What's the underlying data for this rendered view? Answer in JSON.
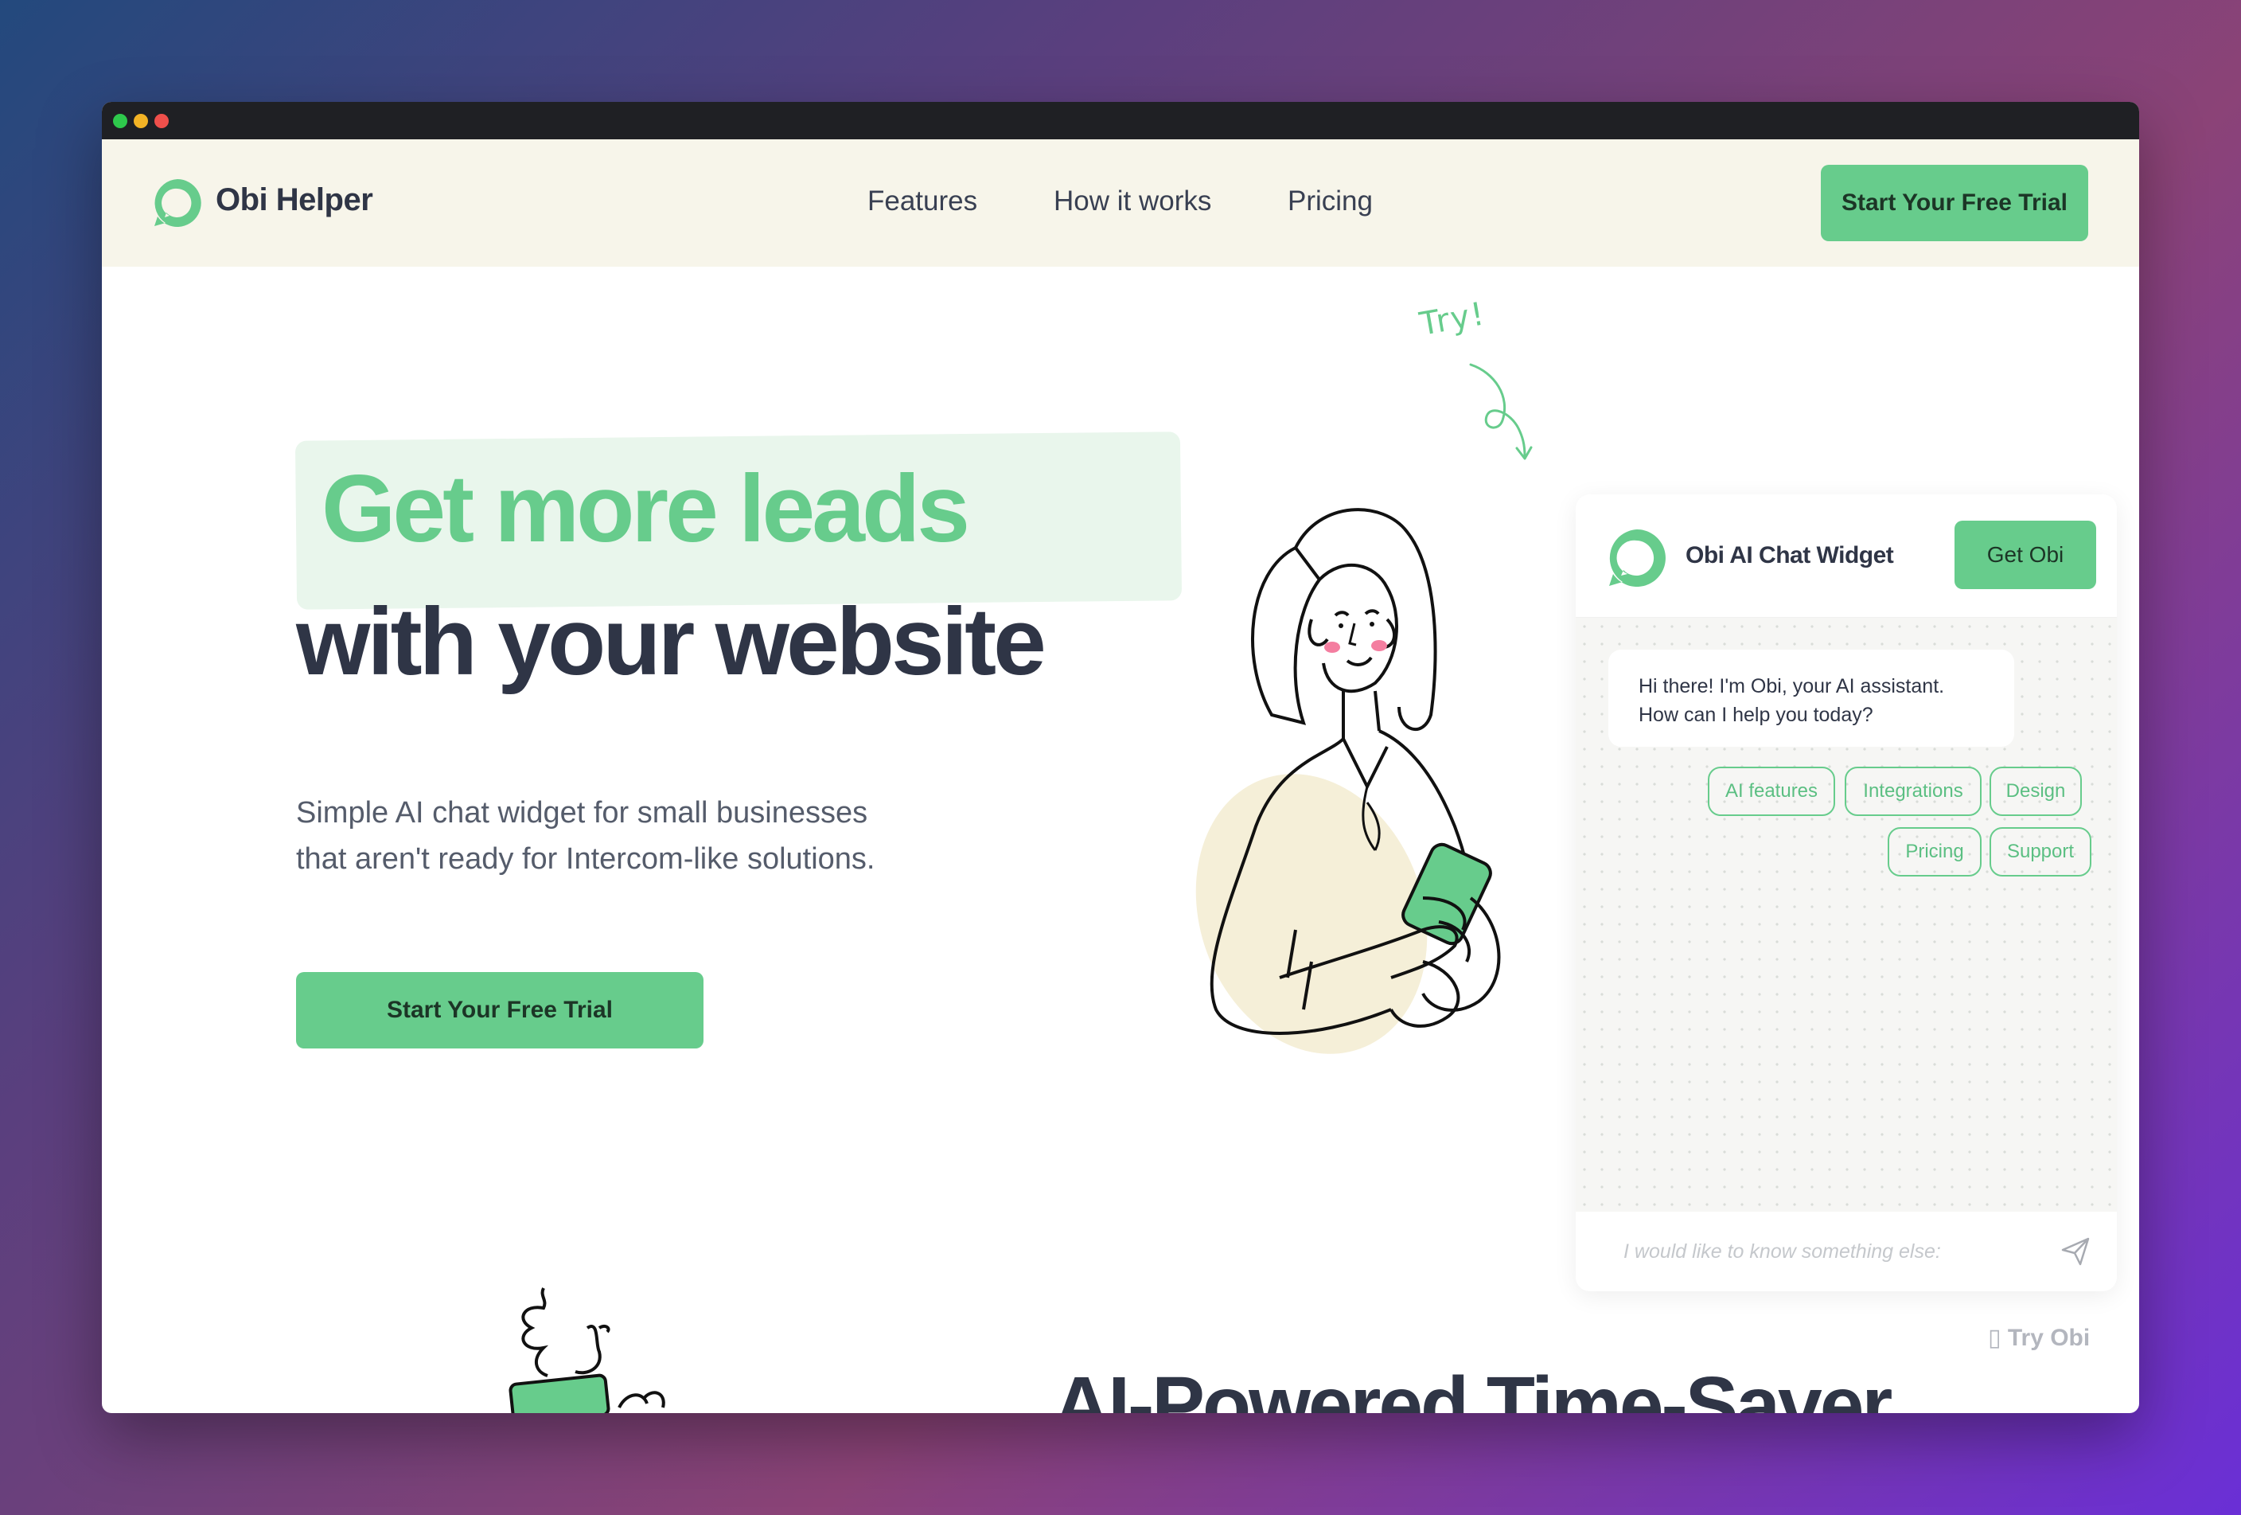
{
  "window": {
    "controls": [
      "green-dot",
      "yellow-dot",
      "red-dot"
    ]
  },
  "nav": {
    "brand": "Obi Helper",
    "links": [
      "Features",
      "How it works",
      "Pricing"
    ],
    "cta": "Start Your Free Trial"
  },
  "hero": {
    "headline_highlight": "Get more leads",
    "headline_rest": "with your website",
    "subtext_line1": "Simple AI chat widget for small businesses",
    "subtext_line2": "that aren't ready for Intercom-like solutions.",
    "cta": "Start Your Free Trial",
    "try_label": "Try!"
  },
  "widget": {
    "title": "Obi AI Chat Widget",
    "get_button": "Get Obi",
    "greeting_line1": "Hi there! I'm Obi, your AI assistant.",
    "greeting_line2": "How can I help you today?",
    "chips": [
      "AI features",
      "Integrations",
      "Design",
      "Pricing",
      "Support"
    ],
    "input_placeholder": "I would like to know something else:"
  },
  "footer": {
    "try_obi": "▯ Try Obi",
    "section_title": "AI-Powered Time-Saver"
  },
  "colors": {
    "accent_green": "#67cc8c",
    "dark_text": "#2f3546",
    "nav_bg": "#f7f5ea",
    "headline_highlight_bg": "#e9f6ec"
  }
}
